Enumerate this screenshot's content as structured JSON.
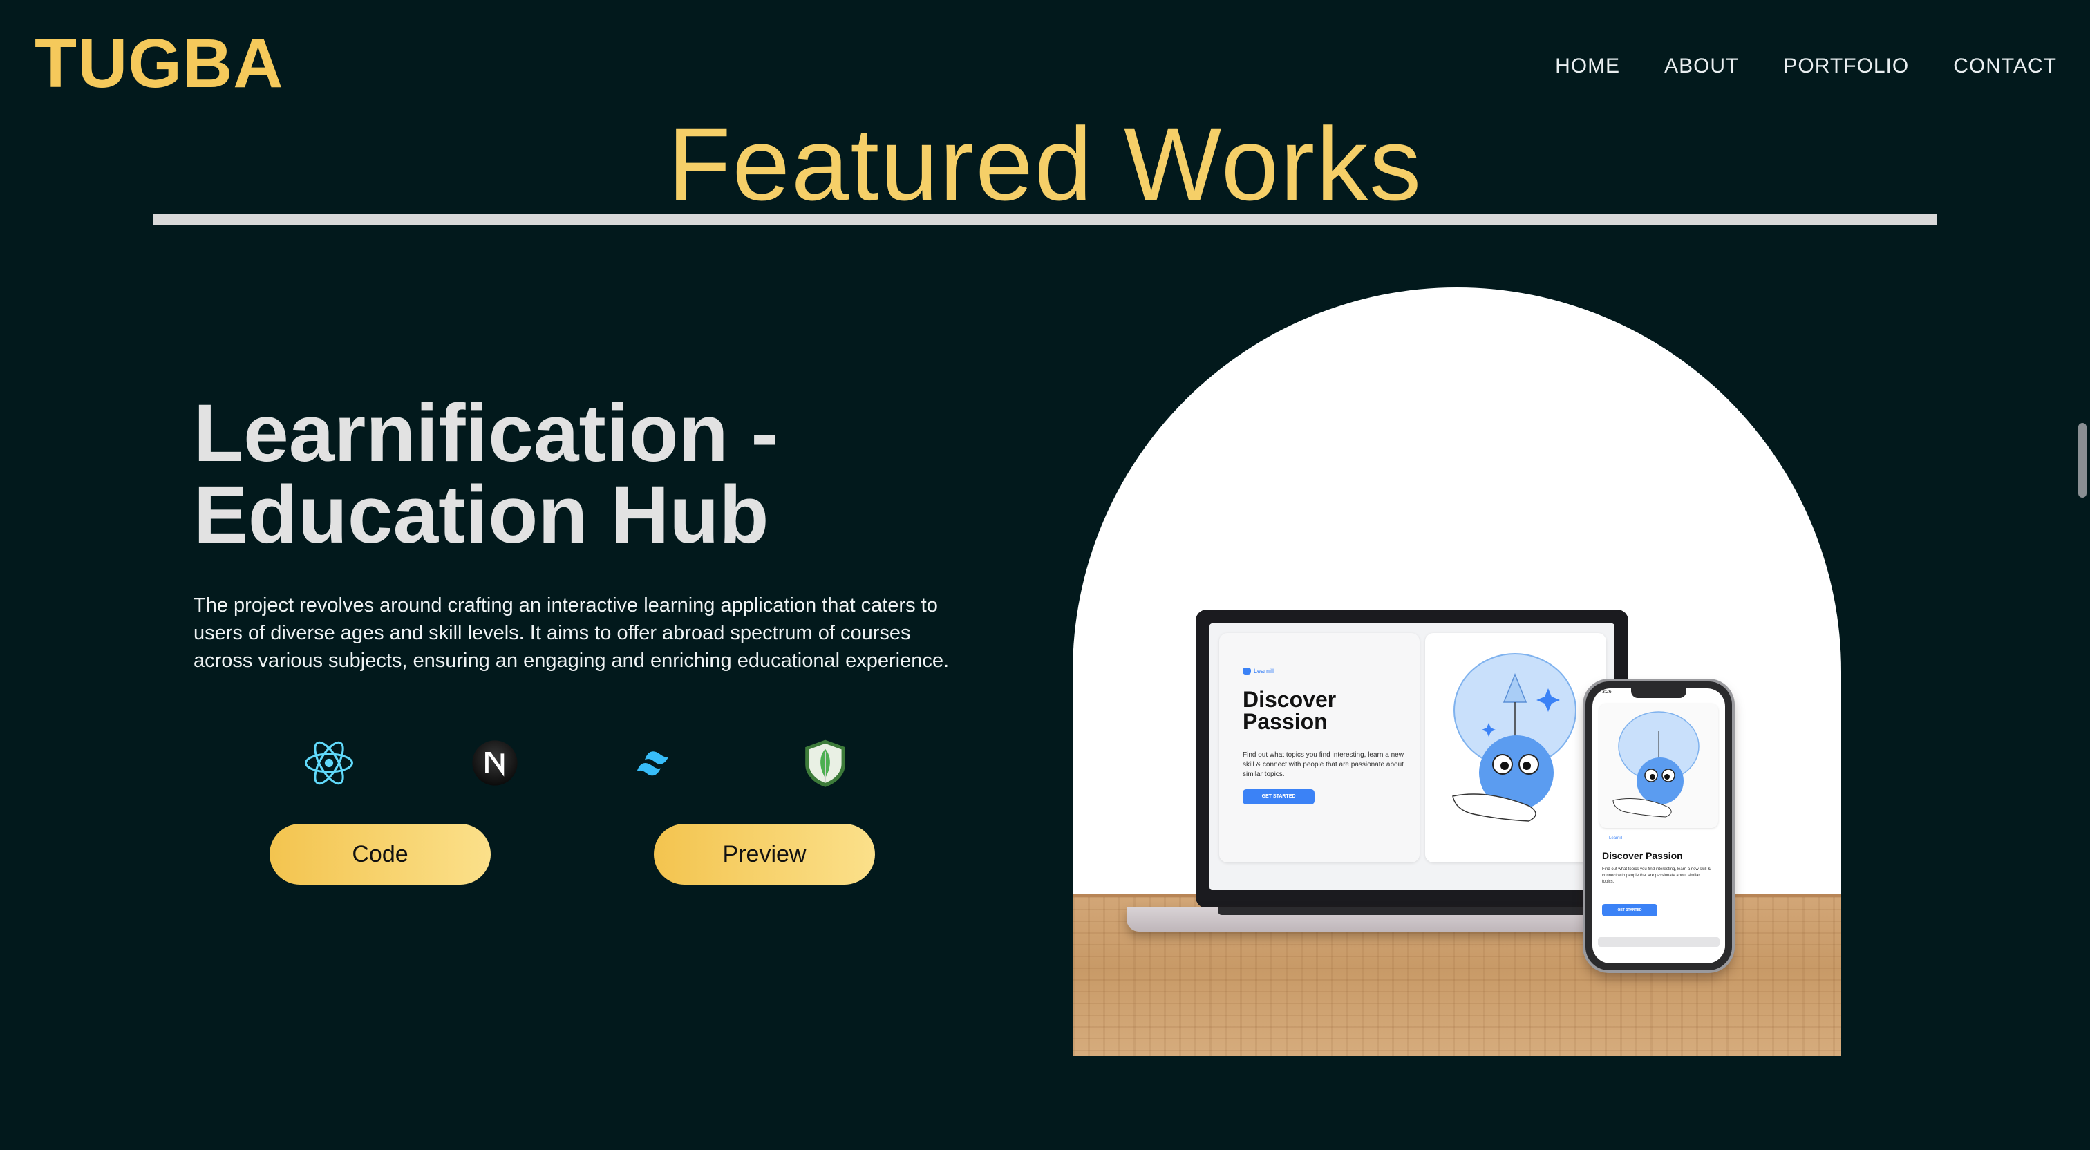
{
  "header": {
    "logo": "TUGBA",
    "nav": [
      "HOME",
      "ABOUT",
      "PORTFOLIO",
      "CONTACT"
    ]
  },
  "section": {
    "title": "Featured Works"
  },
  "project": {
    "title_line1": "Learnification -",
    "title_line2": "Education Hub",
    "description": "The project revolves around crafting an interactive learning application that caters to users of diverse ages and skill levels. It aims to offer abroad spectrum of courses across various subjects, ensuring an engaging and enriching educational experience.",
    "tech_icons": [
      "react-icon",
      "nextjs-icon",
      "tailwind-icon",
      "mongodb-icon"
    ],
    "code_label": "Code",
    "preview_label": "Preview"
  },
  "mockup": {
    "laptop_brand": "Learnill",
    "laptop_heading": "Discover Passion",
    "laptop_sub": "Find out what topics you find interesting, learn a new skill & connect with people that are passionate about similar topics.",
    "laptop_cta": "GET STARTED",
    "phone_time": "3:26",
    "phone_brand": "Learnill",
    "phone_heading": "Discover Passion",
    "phone_sub": "Find out what topics you find interesting, learn a new skill & connect with people that are passionate about similar topics.",
    "phone_cta": "GET STARTED"
  },
  "colors": {
    "background": "#02191c",
    "accent": "#f5c95b",
    "heading_text": "#e2e2e2",
    "button_gradient_start": "#f3c44f",
    "button_gradient_end": "#fbe08a"
  }
}
